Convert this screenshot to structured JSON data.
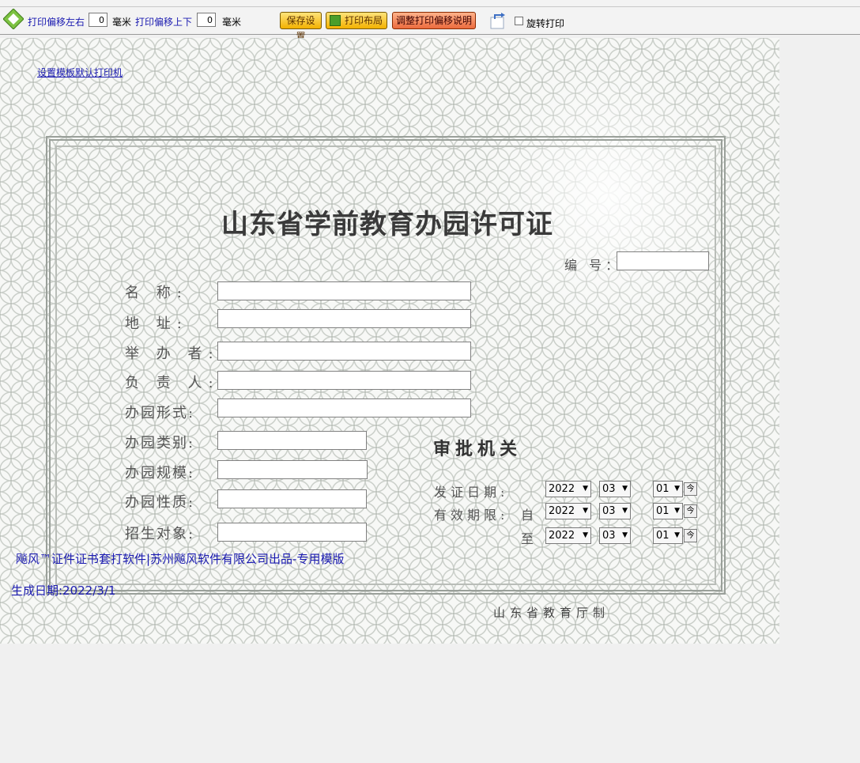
{
  "toolbar": {
    "offset_lr_label": "打印偏移左右",
    "offset_lr_value": "0",
    "unit_mm": "毫米",
    "offset_ud_label": "打印偏移上下",
    "offset_ud_value": "0",
    "save_settings": "保存设置",
    "print_layout": "打印布局",
    "adjust_help": "调整打印偏移说明",
    "rotate_print": "旋转打印"
  },
  "canvas": {
    "set_default_printer": "设置模板默认打印机",
    "title": "山东省学前教育办园许可证",
    "serial_label": "编 号：",
    "fields": [
      {
        "label": "名    称:"
      },
      {
        "label": "地    址:"
      },
      {
        "label": "举 办 者:"
      },
      {
        "label": "负 责 人:"
      },
      {
        "label": "办园形式:"
      },
      {
        "label": "办园类别:"
      },
      {
        "label": "办园规模:"
      },
      {
        "label": "办园性质:"
      },
      {
        "label": "招生对象:"
      }
    ],
    "approval": "审批机关",
    "issue_label": "发证日期:",
    "valid_label": "有效期限:",
    "from_label": "自",
    "to_label": "至",
    "dates": [
      {
        "year": "2022",
        "month": "03",
        "day": "01"
      },
      {
        "year": "2022",
        "month": "03",
        "day": "01"
      },
      {
        "year": "2022",
        "month": "03",
        "day": "01"
      }
    ],
    "today_btn": "今",
    "footer": "飚风™证件证书套打软件|苏州飚风软件有限公司出品-专用模版",
    "generated": "生成日期:2022/3/1",
    "issuer": "山东省教育厅制"
  }
}
